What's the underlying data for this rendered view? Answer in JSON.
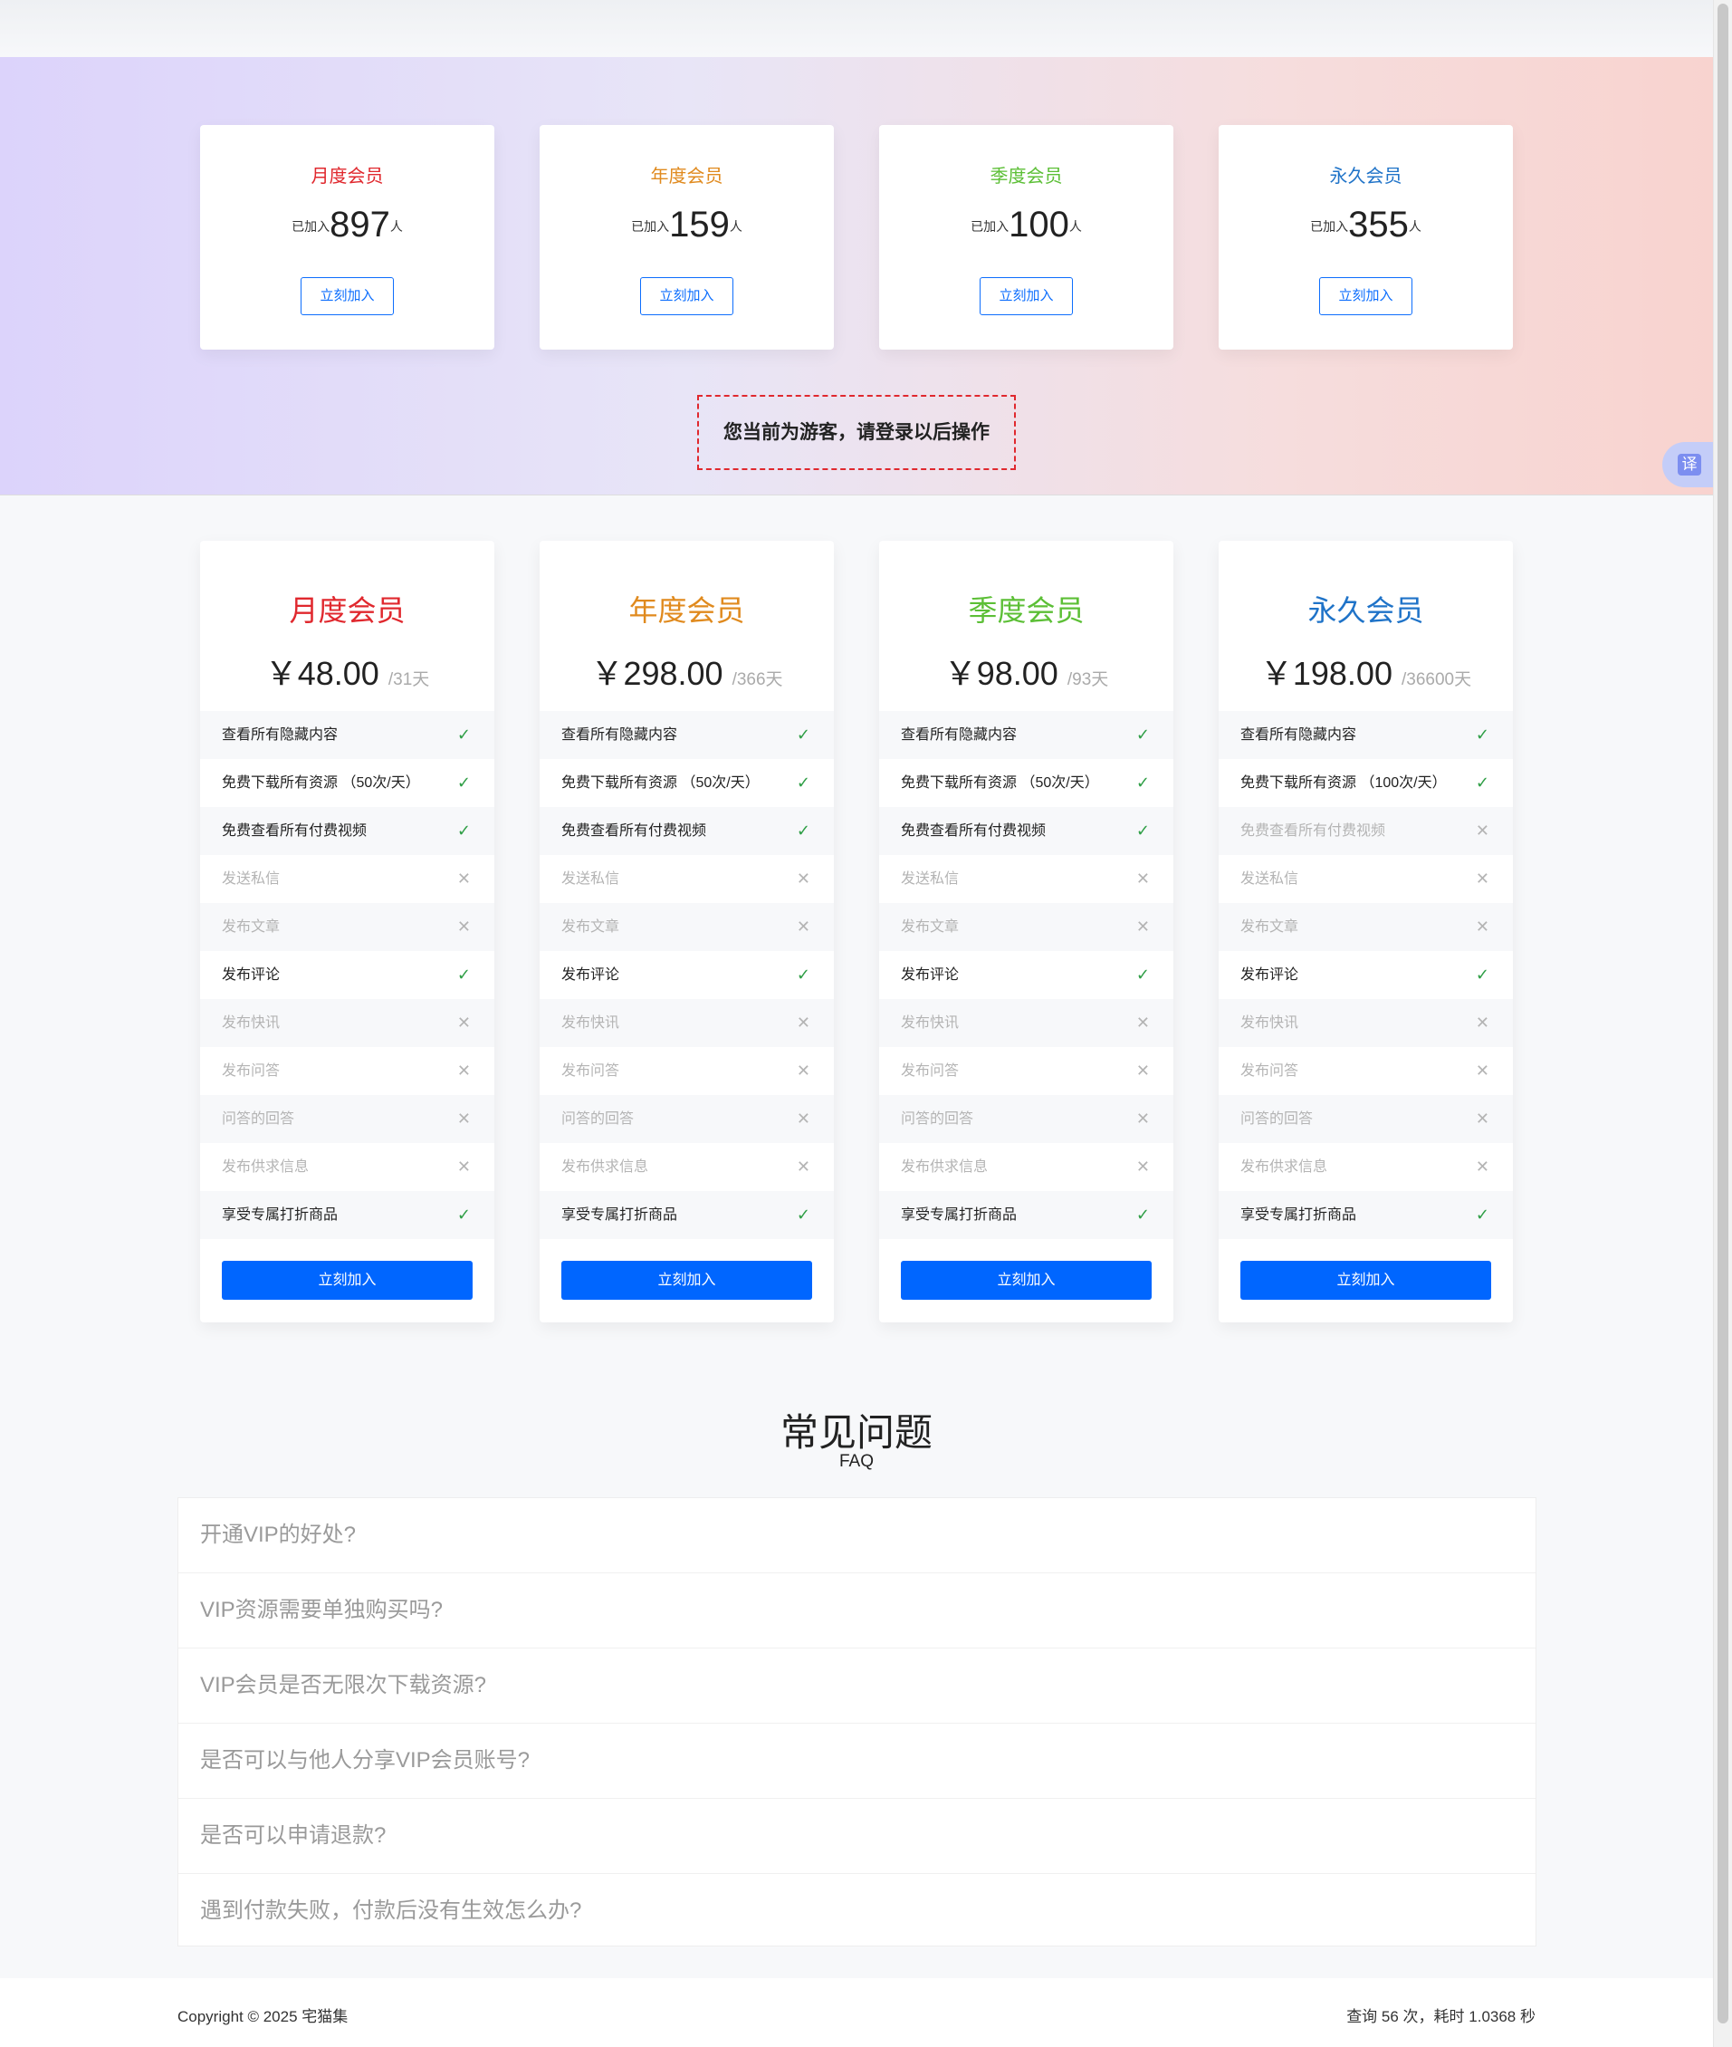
{
  "hero": {
    "notice": "您当前为游客，请登录以后操作",
    "translate_label": "译",
    "joined_prefix": "已加入",
    "joined_suffix": "人",
    "stats": [
      {
        "title": "月度会员",
        "color": "#e0282e",
        "count": "897",
        "button": "立刻加入"
      },
      {
        "title": "年度会员",
        "color": "#e08a1e",
        "count": "159",
        "button": "立刻加入"
      },
      {
        "title": "季度会员",
        "color": "#5cbf36",
        "count": "100",
        "button": "立刻加入"
      },
      {
        "title": "永久会员",
        "color": "#1f73c8",
        "count": "355",
        "button": "立刻加入"
      }
    ]
  },
  "plans": [
    {
      "title": "月度会员",
      "color": "#e0282e",
      "price": "￥48.00",
      "period": "/31天",
      "button": "立刻加入",
      "features": [
        {
          "label": "查看所有隐藏内容",
          "enabled": true
        },
        {
          "label": "免费下载所有资源 （50次/天）",
          "enabled": true
        },
        {
          "label": "免费查看所有付费视频",
          "enabled": true
        },
        {
          "label": "发送私信",
          "enabled": false
        },
        {
          "label": "发布文章",
          "enabled": false
        },
        {
          "label": "发布评论",
          "enabled": true
        },
        {
          "label": "发布快讯",
          "enabled": false
        },
        {
          "label": "发布问答",
          "enabled": false
        },
        {
          "label": "问答的回答",
          "enabled": false
        },
        {
          "label": "发布供求信息",
          "enabled": false
        },
        {
          "label": "享受专属打折商品",
          "enabled": true
        }
      ]
    },
    {
      "title": "年度会员",
      "color": "#e08a1e",
      "price": "￥298.00",
      "period": "/366天",
      "button": "立刻加入",
      "features": [
        {
          "label": "查看所有隐藏内容",
          "enabled": true
        },
        {
          "label": "免费下载所有资源 （50次/天）",
          "enabled": true
        },
        {
          "label": "免费查看所有付费视频",
          "enabled": true
        },
        {
          "label": "发送私信",
          "enabled": false
        },
        {
          "label": "发布文章",
          "enabled": false
        },
        {
          "label": "发布评论",
          "enabled": true
        },
        {
          "label": "发布快讯",
          "enabled": false
        },
        {
          "label": "发布问答",
          "enabled": false
        },
        {
          "label": "问答的回答",
          "enabled": false
        },
        {
          "label": "发布供求信息",
          "enabled": false
        },
        {
          "label": "享受专属打折商品",
          "enabled": true
        }
      ]
    },
    {
      "title": "季度会员",
      "color": "#5cbf36",
      "price": "￥98.00",
      "period": "/93天",
      "button": "立刻加入",
      "features": [
        {
          "label": "查看所有隐藏内容",
          "enabled": true
        },
        {
          "label": "免费下载所有资源 （50次/天）",
          "enabled": true
        },
        {
          "label": "免费查看所有付费视频",
          "enabled": true
        },
        {
          "label": "发送私信",
          "enabled": false
        },
        {
          "label": "发布文章",
          "enabled": false
        },
        {
          "label": "发布评论",
          "enabled": true
        },
        {
          "label": "发布快讯",
          "enabled": false
        },
        {
          "label": "发布问答",
          "enabled": false
        },
        {
          "label": "问答的回答",
          "enabled": false
        },
        {
          "label": "发布供求信息",
          "enabled": false
        },
        {
          "label": "享受专属打折商品",
          "enabled": true
        }
      ]
    },
    {
      "title": "永久会员",
      "color": "#1f73c8",
      "price": "￥198.00",
      "period": "/36600天",
      "button": "立刻加入",
      "features": [
        {
          "label": "查看所有隐藏内容",
          "enabled": true
        },
        {
          "label": "免费下载所有资源 （100次/天）",
          "enabled": true
        },
        {
          "label": "免费查看所有付费视频",
          "enabled": false
        },
        {
          "label": "发送私信",
          "enabled": false
        },
        {
          "label": "发布文章",
          "enabled": false
        },
        {
          "label": "发布评论",
          "enabled": true
        },
        {
          "label": "发布快讯",
          "enabled": false
        },
        {
          "label": "发布问答",
          "enabled": false
        },
        {
          "label": "问答的回答",
          "enabled": false
        },
        {
          "label": "发布供求信息",
          "enabled": false
        },
        {
          "label": "享受专属打折商品",
          "enabled": true
        }
      ]
    }
  ],
  "icons": {
    "enabled": "check-icon",
    "disabled": "cross-icon"
  },
  "faq": {
    "title": "常见问题",
    "subtitle": "FAQ",
    "items": [
      "开通VIP的好处?",
      "VIP资源需要单独购买吗?",
      "VIP会员是否无限次下载资源?",
      "是否可以与他人分享VIP会员账号?",
      "是否可以申请退款?",
      "遇到付款失败，付款后没有生效怎么办?"
    ]
  },
  "footer": {
    "copyright": "Copyright © 2025 宅猫集",
    "stats": "查询 56 次，耗时 1.0368 秒"
  }
}
